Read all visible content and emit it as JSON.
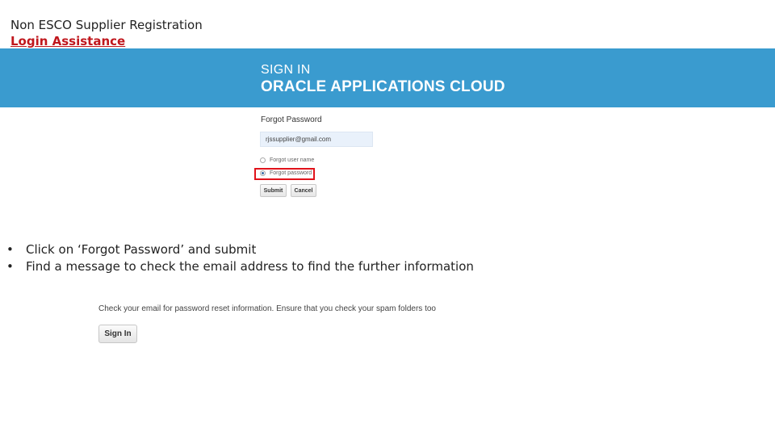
{
  "document": {
    "title": "Non ESCO Supplier Registration",
    "subtitle": "Login Assistance"
  },
  "banner": {
    "line1": "SIGN IN",
    "line2": "ORACLE APPLICATIONS CLOUD",
    "color": "#3a9bcf"
  },
  "forgot_panel": {
    "title": "Forgot Password",
    "email_value": "rjssupplier@gmail.com",
    "options": [
      {
        "label": "Forgot user name",
        "checked": false
      },
      {
        "label": "Forgot password",
        "checked": true
      }
    ],
    "submit_label": "Submit",
    "cancel_label": "Cancel",
    "highlight_color": "#e1131b"
  },
  "instructions": [
    "Click on ‘Forgot Password’ and submit",
    "Find a message to check the email address to find the further information"
  ],
  "result": {
    "message": "Check your email for password reset information. Ensure that you check your spam folders too",
    "signin_label": "Sign In"
  }
}
